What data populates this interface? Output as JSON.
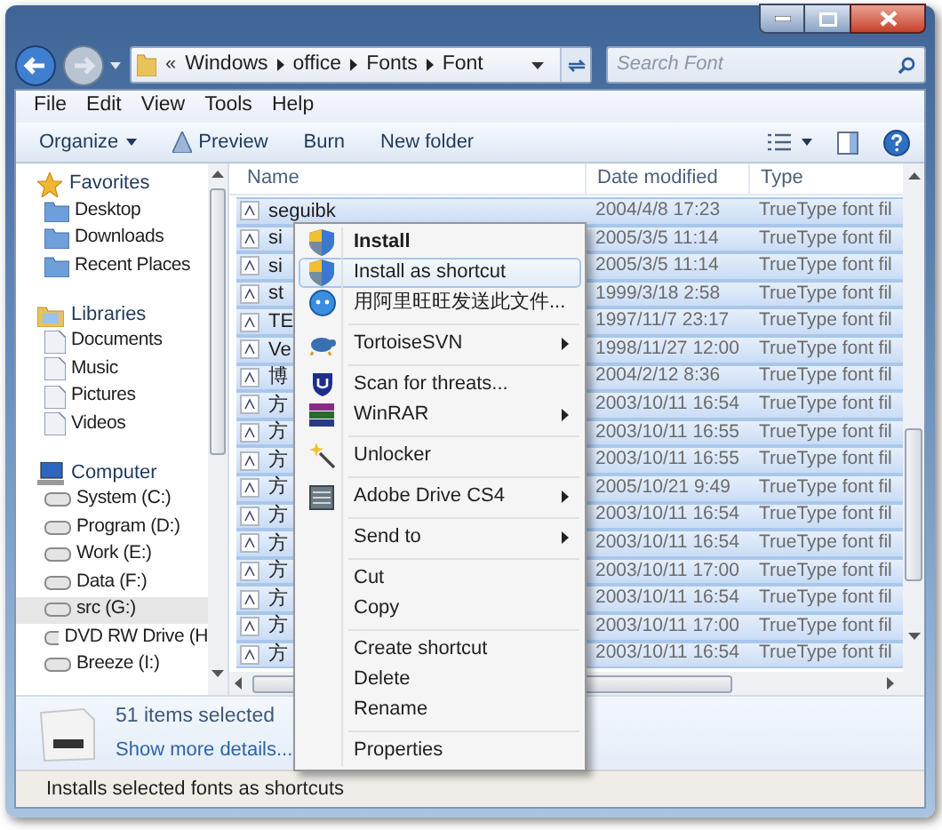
{
  "address": {
    "overflow": "«",
    "crumbs": [
      "Windows",
      "office",
      "Fonts",
      "Font"
    ]
  },
  "search": {
    "placeholder": "Search Font"
  },
  "menu_bar": [
    "File",
    "Edit",
    "View",
    "Tools",
    "Help"
  ],
  "toolbar": [
    {
      "label": "Organize",
      "kind": "dropdown"
    },
    {
      "label": "Preview",
      "kind": "icon"
    },
    {
      "label": "Burn",
      "kind": "plain"
    },
    {
      "label": "New folder",
      "kind": "plain"
    }
  ],
  "nav": [
    {
      "label": "Favorites",
      "children": [
        {
          "label": "Desktop",
          "selected": false
        },
        {
          "label": "Downloads",
          "selected": false
        },
        {
          "label": "Recent Places",
          "selected": false
        }
      ]
    },
    {
      "label": "Libraries",
      "children": [
        {
          "label": "Documents",
          "selected": false
        },
        {
          "label": "Music",
          "selected": false
        },
        {
          "label": "Pictures",
          "selected": false
        },
        {
          "label": "Videos",
          "selected": false
        }
      ]
    },
    {
      "label": "Computer",
      "children": [
        {
          "label": "System (C:)",
          "selected": false
        },
        {
          "label": "Program (D:)",
          "selected": false
        },
        {
          "label": "Work (E:)",
          "selected": false
        },
        {
          "label": "Data (F:)",
          "selected": false
        },
        {
          "label": "src (G:)",
          "selected": true
        },
        {
          "label": "DVD RW Drive (H",
          "selected": false
        },
        {
          "label": "Breeze (I:)",
          "selected": false
        }
      ]
    }
  ],
  "columns": [
    "Name",
    "Date modified",
    "Type"
  ],
  "files": [
    {
      "name": "seguibk",
      "date": "2004/4/8 17:23",
      "type": "TrueType font fil",
      "selected": true
    },
    {
      "name": "si",
      "date": "2005/3/5 11:14",
      "type": "TrueType font fil",
      "selected": true
    },
    {
      "name": "si",
      "date": "2005/3/5 11:14",
      "type": "TrueType font fil",
      "selected": true
    },
    {
      "name": "st",
      "date": "1999/3/18 2:58",
      "type": "TrueType font fil",
      "selected": true
    },
    {
      "name": "TE",
      "date": "1997/11/7 23:17",
      "type": "TrueType font fil",
      "selected": true
    },
    {
      "name": "Ve",
      "date": "1998/11/27 12:00",
      "type": "TrueType font fil",
      "selected": true
    },
    {
      "name": "博",
      "date": "2004/2/12 8:36",
      "type": "TrueType font fil",
      "selected": true
    },
    {
      "name": "方",
      "date": "2003/10/11 16:54",
      "type": "TrueType font fil",
      "selected": true
    },
    {
      "name": "方",
      "date": "2003/10/11 16:55",
      "type": "TrueType font fil",
      "selected": true
    },
    {
      "name": "方",
      "date": "2003/10/11 16:55",
      "type": "TrueType font fil",
      "selected": true
    },
    {
      "name": "方",
      "date": "2005/10/21 9:49",
      "type": "TrueType font fil",
      "selected": true
    },
    {
      "name": "方",
      "date": "2003/10/11 16:54",
      "type": "TrueType font fil",
      "selected": true
    },
    {
      "name": "方",
      "date": "2003/10/11 16:54",
      "type": "TrueType font fil",
      "selected": true
    },
    {
      "name": "方",
      "date": "2003/10/11 17:00",
      "type": "TrueType font fil",
      "selected": true
    },
    {
      "name": "方",
      "date": "2003/10/11 16:54",
      "type": "TrueType font fil",
      "selected": true
    },
    {
      "name": "方",
      "date": "2003/10/11 17:00",
      "type": "TrueType font fil",
      "selected": true
    },
    {
      "name": "方",
      "date": "2003/10/11 16:54",
      "type": "TrueType font fil",
      "selected": true
    }
  ],
  "context_menu": [
    {
      "kind": "item",
      "label": "Install",
      "bold": true,
      "selected": false,
      "submenu": false
    },
    {
      "kind": "item",
      "label": "Install as shortcut",
      "bold": false,
      "selected": true,
      "submenu": false
    },
    {
      "kind": "item",
      "label": "用阿里旺旺发送此文件...",
      "bold": false,
      "selected": false,
      "submenu": false
    },
    {
      "kind": "separator"
    },
    {
      "kind": "item",
      "label": "TortoiseSVN",
      "bold": false,
      "selected": false,
      "submenu": true
    },
    {
      "kind": "separator"
    },
    {
      "kind": "item",
      "label": "Scan for threats...",
      "bold": false,
      "selected": false,
      "submenu": false
    },
    {
      "kind": "item",
      "label": "WinRAR",
      "bold": false,
      "selected": false,
      "submenu": true
    },
    {
      "kind": "separator"
    },
    {
      "kind": "item",
      "label": "Unlocker",
      "bold": false,
      "selected": false,
      "submenu": false
    },
    {
      "kind": "separator"
    },
    {
      "kind": "item",
      "label": "Adobe Drive CS4",
      "bold": false,
      "selected": false,
      "submenu": true
    },
    {
      "kind": "separator"
    },
    {
      "kind": "item",
      "label": "Send to",
      "bold": false,
      "selected": false,
      "submenu": true
    },
    {
      "kind": "separator"
    },
    {
      "kind": "item",
      "label": "Cut",
      "bold": false,
      "selected": false,
      "submenu": false
    },
    {
      "kind": "item",
      "label": "Copy",
      "bold": false,
      "selected": false,
      "submenu": false
    },
    {
      "kind": "separator"
    },
    {
      "kind": "item",
      "label": "Create shortcut",
      "bold": false,
      "selected": false,
      "submenu": false
    },
    {
      "kind": "item",
      "label": "Delete",
      "bold": false,
      "selected": false,
      "submenu": false
    },
    {
      "kind": "item",
      "label": "Rename",
      "bold": false,
      "selected": false,
      "submenu": false
    },
    {
      "kind": "separator"
    },
    {
      "kind": "item",
      "label": "Properties",
      "bold": false,
      "selected": false,
      "submenu": false
    }
  ],
  "details": {
    "count": "51 items selected",
    "link": "Show more details..."
  },
  "status_bar": "Installs selected fonts as shortcuts"
}
